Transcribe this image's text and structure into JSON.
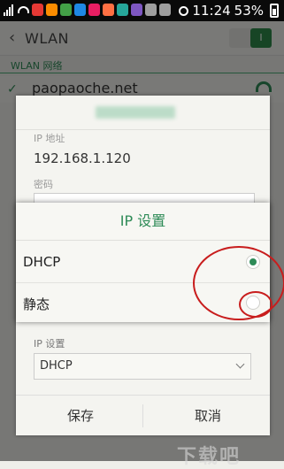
{
  "status_bar": {
    "time": "11:24",
    "battery": "53%",
    "notification_icon_colors": [
      "#e53935",
      "#fb8c00",
      "#43a047",
      "#1e88e5",
      "#e91e63",
      "#ff7043",
      "#26a69a",
      "#7e57c2",
      "#9e9e9e",
      "#9e9e9e"
    ]
  },
  "header": {
    "title": "WLAN",
    "toggle_label": "I"
  },
  "section_label": "WLAN 网络",
  "network": {
    "name": "paopaoche.net"
  },
  "sheet": {
    "ip_label": "IP 地址",
    "ip_value": "192.168.1.120",
    "password_label": "密码",
    "ip_settings_label": "IP 设置",
    "ip_settings_value": "DHCP",
    "save_label": "保存",
    "cancel_label": "取消"
  },
  "dialog": {
    "title": "IP 设置",
    "options": [
      {
        "label": "DHCP",
        "selected": true
      },
      {
        "label": "静态",
        "selected": false
      }
    ]
  },
  "watermark": "下载吧",
  "colors": {
    "accent": "#2e8b57",
    "annotation": "#c81d1d"
  }
}
